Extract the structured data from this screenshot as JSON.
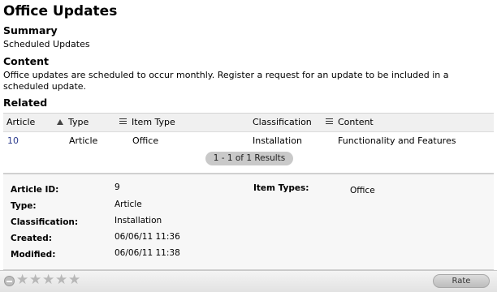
{
  "page": {
    "title": "Office Updates",
    "summary_heading": "Summary",
    "summary_text": "Scheduled Updates",
    "content_heading": "Content",
    "content_text": "Office updates are scheduled to occur monthly. Register a request for an update to be included in a scheduled update.",
    "related_heading": "Related"
  },
  "related": {
    "columns": [
      "Article",
      "Type",
      "Item Type",
      "Classification",
      "Content"
    ],
    "rows": [
      {
        "article": "10",
        "type": "Article",
        "item_type": "Office",
        "classification": "Installation",
        "content": "Functionality and Features"
      }
    ],
    "pager": "1 - 1 of 1 Results"
  },
  "details": {
    "article_id_label": "Article ID:",
    "article_id": "9",
    "type_label": "Type:",
    "type": "Article",
    "classification_label": "Classification:",
    "classification": "Installation",
    "created_label": "Created:",
    "created": "06/06/11 11:36",
    "modified_label": "Modified:",
    "modified": "06/06/11 11:38",
    "item_types_label": "Item Types:",
    "item_types": "Office"
  },
  "footer": {
    "rating_stars": 5,
    "rating_value": 0,
    "rate_label": "Rate"
  }
}
